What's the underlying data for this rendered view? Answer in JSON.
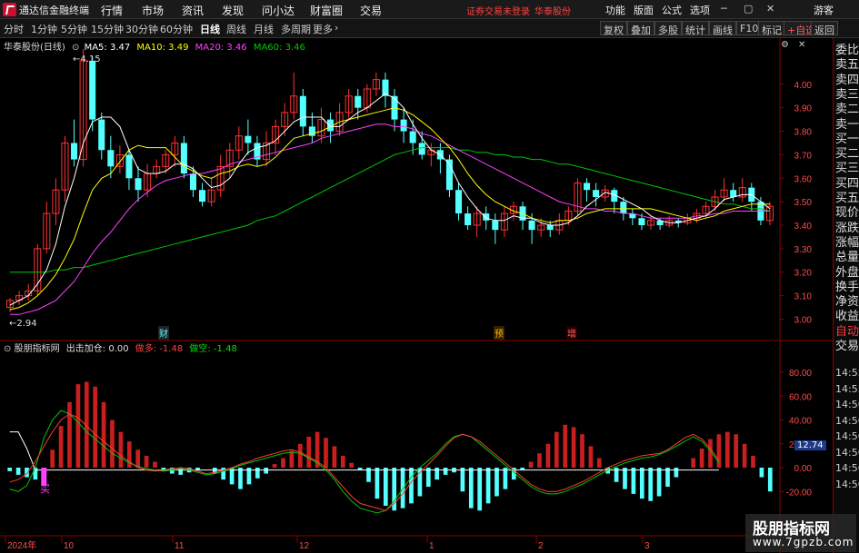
{
  "titlebar": {
    "app_name": "通达信金融终端",
    "menus": [
      "行情",
      "市场",
      "资讯",
      "发现",
      "问小达",
      "财富圈",
      "交易"
    ],
    "warning": "证券交易未登录",
    "broker": "华泰股份",
    "right_menus": [
      "功能",
      "版面",
      "公式",
      "选项"
    ],
    "guest": "游客"
  },
  "toolbar": {
    "periods": [
      "分时",
      "1分钟",
      "5分钟",
      "15分钟",
      "30分钟",
      "60分钟",
      "日线",
      "周线",
      "月线",
      "多周期",
      "更多"
    ],
    "active_period": "日线",
    "buttons": [
      "复权",
      "叠加",
      "多股",
      "统计",
      "画线",
      "F10",
      "标记",
      "+自选",
      "返回"
    ]
  },
  "main_chart": {
    "title": "华泰股份(日线)",
    "ma5_label": "MA5: 3.47",
    "ma10_label": "MA10: 3.49",
    "ma20_label": "MA20: 3.46",
    "ma60_label": "MA60: 3.46",
    "high_label": "4.15",
    "low_label": "2.94",
    "y_ticks": [
      "4.00",
      "3.90",
      "3.80",
      "3.70",
      "3.60",
      "3.50",
      "3.40",
      "3.30",
      "3.20",
      "3.10",
      "3.00"
    ],
    "markers": [
      "财",
      "预",
      "增"
    ],
    "colors": {
      "up": "#ff3232",
      "down": "#54ffff",
      "ma5": "#ffffff",
      "ma10": "#ffff00",
      "ma20": "#ff40ff",
      "ma60": "#00c800"
    }
  },
  "indicator": {
    "title": "股朋指标网",
    "label1": "出击加仓: 0.00",
    "label2": "做多: -1.48",
    "label3": "做空: -1.48",
    "buy_label": "买",
    "y_ticks": [
      "80.00",
      "60.00",
      "40.00",
      "20.00",
      "0.00",
      "-20.00"
    ],
    "current_value": "12.74"
  },
  "xaxis": {
    "labels": [
      "2024年",
      "10",
      "11",
      "12",
      "1",
      "2",
      "3"
    ]
  },
  "right_panel": {
    "items": [
      "委比",
      "卖五",
      "卖四",
      "卖三",
      "卖二",
      "卖一",
      "买一",
      "买二",
      "买三",
      "买四",
      "买五",
      "现价",
      "涨跌",
      "涨幅",
      "总量",
      "外盘",
      "换手",
      "净资",
      "收益",
      "自动",
      "交易",
      "14:55",
      "14:55",
      "14:56",
      "14:56",
      "14:56",
      "14:56",
      "14:56",
      "14:56"
    ]
  },
  "chart_data": {
    "type": "candlestick",
    "title": "华泰股份(日线)",
    "y_range": [
      2.94,
      4.15
    ],
    "candles": [
      [
        3.05,
        3.08,
        3.03,
        3.09
      ],
      [
        3.08,
        3.1,
        3.06,
        3.12
      ],
      [
        3.1,
        3.12,
        3.08,
        3.15
      ],
      [
        3.12,
        3.3,
        3.1,
        3.32
      ],
      [
        3.3,
        3.45,
        3.28,
        3.5
      ],
      [
        3.45,
        3.55,
        3.4,
        3.6
      ],
      [
        3.55,
        3.75,
        3.5,
        3.78
      ],
      [
        3.75,
        3.68,
        3.65,
        3.85
      ],
      [
        3.68,
        4.1,
        3.65,
        4.15
      ],
      [
        4.1,
        3.85,
        3.8,
        4.12
      ],
      [
        3.85,
        3.72,
        3.68,
        3.88
      ],
      [
        3.72,
        3.65,
        3.6,
        3.78
      ],
      [
        3.65,
        3.7,
        3.62,
        3.74
      ],
      [
        3.7,
        3.6,
        3.55,
        3.72
      ],
      [
        3.6,
        3.55,
        3.5,
        3.65
      ],
      [
        3.55,
        3.62,
        3.52,
        3.66
      ],
      [
        3.62,
        3.65,
        3.6,
        3.68
      ],
      [
        3.65,
        3.7,
        3.62,
        3.72
      ],
      [
        3.7,
        3.75,
        3.65,
        3.78
      ],
      [
        3.75,
        3.62,
        3.6,
        3.78
      ],
      [
        3.62,
        3.55,
        3.52,
        3.65
      ],
      [
        3.55,
        3.5,
        3.48,
        3.58
      ],
      [
        3.5,
        3.55,
        3.48,
        3.6
      ],
      [
        3.55,
        3.65,
        3.52,
        3.7
      ],
      [
        3.65,
        3.72,
        3.6,
        3.75
      ],
      [
        3.72,
        3.78,
        3.68,
        3.82
      ],
      [
        3.78,
        3.75,
        3.7,
        3.85
      ],
      [
        3.75,
        3.68,
        3.65,
        3.78
      ],
      [
        3.68,
        3.75,
        3.65,
        3.8
      ],
      [
        3.75,
        3.82,
        3.7,
        3.85
      ],
      [
        3.82,
        3.88,
        3.78,
        3.92
      ],
      [
        3.88,
        3.95,
        3.85,
        4.05
      ],
      [
        3.95,
        3.82,
        3.78,
        3.98
      ],
      [
        3.82,
        3.78,
        3.75,
        3.88
      ],
      [
        3.78,
        3.85,
        3.75,
        3.9
      ],
      [
        3.85,
        3.8,
        3.75,
        3.88
      ],
      [
        3.8,
        3.88,
        3.78,
        3.92
      ],
      [
        3.88,
        3.95,
        3.85,
        3.98
      ],
      [
        3.95,
        3.9,
        3.85,
        3.98
      ],
      [
        3.9,
        3.98,
        3.88,
        4.0
      ],
      [
        3.98,
        4.02,
        3.95,
        4.05
      ],
      [
        4.02,
        3.95,
        3.9,
        4.05
      ],
      [
        3.95,
        3.85,
        3.8,
        3.98
      ],
      [
        3.85,
        3.8,
        3.75,
        3.9
      ],
      [
        3.8,
        3.75,
        3.7,
        3.85
      ],
      [
        3.75,
        3.7,
        3.68,
        3.8
      ],
      [
        3.7,
        3.72,
        3.65,
        3.75
      ],
      [
        3.72,
        3.68,
        3.62,
        3.75
      ],
      [
        3.68,
        3.55,
        3.52,
        3.7
      ],
      [
        3.55,
        3.45,
        3.42,
        3.58
      ],
      [
        3.45,
        3.4,
        3.38,
        3.48
      ],
      [
        3.4,
        3.45,
        3.35,
        3.48
      ],
      [
        3.45,
        3.42,
        3.38,
        3.48
      ],
      [
        3.42,
        3.38,
        3.32,
        3.45
      ],
      [
        3.38,
        3.45,
        3.35,
        3.48
      ],
      [
        3.45,
        3.48,
        3.42,
        3.5
      ],
      [
        3.48,
        3.42,
        3.38,
        3.5
      ],
      [
        3.42,
        3.38,
        3.32,
        3.45
      ],
      [
        3.38,
        3.4,
        3.35,
        3.43
      ],
      [
        3.4,
        3.38,
        3.35,
        3.42
      ],
      [
        3.38,
        3.42,
        3.36,
        3.45
      ],
      [
        3.42,
        3.46,
        3.4,
        3.48
      ],
      [
        3.46,
        3.58,
        3.44,
        3.6
      ],
      [
        3.58,
        3.55,
        3.5,
        3.6
      ],
      [
        3.55,
        3.52,
        3.48,
        3.58
      ],
      [
        3.52,
        3.55,
        3.5,
        3.57
      ],
      [
        3.55,
        3.5,
        3.45,
        3.56
      ],
      [
        3.5,
        3.45,
        3.42,
        3.52
      ],
      [
        3.45,
        3.43,
        3.4,
        3.47
      ],
      [
        3.43,
        3.4,
        3.38,
        3.45
      ],
      [
        3.4,
        3.42,
        3.38,
        3.44
      ],
      [
        3.42,
        3.4,
        3.38,
        3.43
      ],
      [
        3.4,
        3.42,
        3.39,
        3.44
      ],
      [
        3.42,
        3.41,
        3.39,
        3.43
      ],
      [
        3.41,
        3.43,
        3.4,
        3.45
      ],
      [
        3.43,
        3.45,
        3.41,
        3.47
      ],
      [
        3.45,
        3.48,
        3.43,
        3.5
      ],
      [
        3.48,
        3.52,
        3.46,
        3.55
      ],
      [
        3.52,
        3.55,
        3.5,
        3.6
      ],
      [
        3.55,
        3.52,
        3.5,
        3.58
      ],
      [
        3.52,
        3.56,
        3.5,
        3.6
      ],
      [
        3.56,
        3.5,
        3.46,
        3.58
      ],
      [
        3.5,
        3.42,
        3.4,
        3.52
      ],
      [
        3.42,
        3.48,
        3.4,
        3.5
      ]
    ],
    "ma5": [
      3.06,
      3.08,
      3.1,
      3.15,
      3.21,
      3.32,
      3.48,
      3.6,
      3.75,
      3.84,
      3.86,
      3.86,
      3.82,
      3.72,
      3.64,
      3.62,
      3.62,
      3.63,
      3.66,
      3.66,
      3.64,
      3.6,
      3.56,
      3.57,
      3.6,
      3.66,
      3.71,
      3.73,
      3.74,
      3.76,
      3.8,
      3.84,
      3.86,
      3.86,
      3.86,
      3.82,
      3.82,
      3.85,
      3.88,
      3.9,
      3.93,
      3.96,
      3.94,
      3.9,
      3.83,
      3.77,
      3.72,
      3.7,
      3.66,
      3.58,
      3.52,
      3.47,
      3.43,
      3.42,
      3.42,
      3.44,
      3.43,
      3.43,
      3.41,
      3.4,
      3.4,
      3.41,
      3.44,
      3.48,
      3.51,
      3.54,
      3.53,
      3.51,
      3.49,
      3.47,
      3.44,
      3.42,
      3.41,
      3.41,
      3.42,
      3.43,
      3.44,
      3.47,
      3.51,
      3.52,
      3.53,
      3.53,
      3.5,
      3.47
    ],
    "ma10": [
      3.04,
      3.05,
      3.07,
      3.1,
      3.14,
      3.19,
      3.26,
      3.34,
      3.45,
      3.55,
      3.6,
      3.62,
      3.67,
      3.72,
      3.74,
      3.73,
      3.73,
      3.73,
      3.69,
      3.65,
      3.63,
      3.61,
      3.6,
      3.62,
      3.63,
      3.65,
      3.66,
      3.65,
      3.66,
      3.69,
      3.73,
      3.77,
      3.78,
      3.79,
      3.8,
      3.82,
      3.84,
      3.85,
      3.86,
      3.87,
      3.88,
      3.89,
      3.9,
      3.89,
      3.87,
      3.84,
      3.81,
      3.77,
      3.73,
      3.68,
      3.62,
      3.57,
      3.53,
      3.5,
      3.48,
      3.46,
      3.45,
      3.43,
      3.42,
      3.41,
      3.42,
      3.42,
      3.43,
      3.45,
      3.46,
      3.47,
      3.47,
      3.47,
      3.47,
      3.47,
      3.47,
      3.46,
      3.45,
      3.44,
      3.43,
      3.42,
      3.43,
      3.44,
      3.46,
      3.47,
      3.48,
      3.49,
      3.49,
      3.49
    ],
    "ma20": [
      3.02,
      3.02,
      3.03,
      3.04,
      3.06,
      3.08,
      3.12,
      3.16,
      3.22,
      3.28,
      3.33,
      3.37,
      3.42,
      3.47,
      3.51,
      3.54,
      3.57,
      3.59,
      3.6,
      3.61,
      3.62,
      3.62,
      3.63,
      3.64,
      3.66,
      3.67,
      3.68,
      3.69,
      3.7,
      3.71,
      3.72,
      3.73,
      3.74,
      3.75,
      3.77,
      3.78,
      3.79,
      3.8,
      3.81,
      3.82,
      3.83,
      3.83,
      3.82,
      3.82,
      3.81,
      3.79,
      3.78,
      3.76,
      3.74,
      3.72,
      3.7,
      3.68,
      3.66,
      3.64,
      3.62,
      3.6,
      3.58,
      3.56,
      3.54,
      3.52,
      3.5,
      3.49,
      3.48,
      3.47,
      3.47,
      3.46,
      3.46,
      3.45,
      3.45,
      3.44,
      3.43,
      3.43,
      3.43,
      3.43,
      3.43,
      3.44,
      3.44,
      3.45,
      3.45,
      3.46,
      3.46,
      3.46,
      3.46,
      3.46
    ],
    "ma60": [
      3.2,
      3.2,
      3.2,
      3.2,
      3.2,
      3.21,
      3.21,
      3.22,
      3.22,
      3.23,
      3.24,
      3.25,
      3.26,
      3.27,
      3.28,
      3.29,
      3.3,
      3.31,
      3.32,
      3.33,
      3.34,
      3.35,
      3.36,
      3.37,
      3.38,
      3.39,
      3.4,
      3.42,
      3.43,
      3.44,
      3.46,
      3.48,
      3.5,
      3.52,
      3.54,
      3.56,
      3.58,
      3.6,
      3.62,
      3.64,
      3.66,
      3.68,
      3.7,
      3.71,
      3.72,
      3.73,
      3.73,
      3.73,
      3.73,
      3.72,
      3.72,
      3.71,
      3.71,
      3.7,
      3.7,
      3.69,
      3.69,
      3.68,
      3.68,
      3.67,
      3.66,
      3.66,
      3.65,
      3.64,
      3.63,
      3.62,
      3.61,
      3.6,
      3.59,
      3.58,
      3.57,
      3.56,
      3.55,
      3.54,
      3.53,
      3.52,
      3.51,
      3.5,
      3.49,
      3.49,
      3.48,
      3.47,
      3.47,
      3.46
    ],
    "osc_bars": [
      -3,
      -6,
      -8,
      -10,
      -12,
      15,
      35,
      55,
      70,
      72,
      68,
      55,
      40,
      30,
      22,
      15,
      10,
      5,
      -3,
      -5,
      -6,
      -4,
      -2,
      0,
      -5,
      -10,
      -14,
      -18,
      -14,
      -9,
      -5,
      3,
      8,
      14,
      20,
      26,
      30,
      25,
      18,
      10,
      4,
      -2,
      -12,
      -26,
      -32,
      -36,
      -34,
      -30,
      -24,
      -16,
      -10,
      -6,
      -4,
      -20,
      -34,
      -36,
      -30,
      -24,
      -18,
      -10,
      -2,
      5,
      12,
      20,
      30,
      36,
      34,
      28,
      18,
      8,
      -5,
      -12,
      -18,
      -22,
      -26,
      -28,
      -24,
      -16,
      -8,
      0,
      8,
      16,
      24,
      28,
      30,
      28,
      20,
      10,
      -8,
      -20
    ],
    "osc_red": [
      -12,
      -10,
      -5,
      5,
      18,
      30,
      40,
      45,
      42,
      35,
      28,
      22,
      16,
      10,
      5,
      0,
      -2,
      -3,
      -2,
      -1,
      0,
      -1,
      -3,
      -5,
      -4,
      -2,
      0,
      3,
      5,
      8,
      10,
      12,
      14,
      15,
      13,
      9,
      5,
      0,
      -8,
      -16,
      -24,
      -30,
      -32,
      -34,
      -36,
      -30,
      -22,
      -12,
      -4,
      3,
      10,
      18,
      25,
      28,
      26,
      22,
      16,
      10,
      4,
      -2,
      -8,
      -14,
      -18,
      -20,
      -20,
      -18,
      -15,
      -12,
      -8,
      -4,
      0,
      3,
      6,
      8,
      10,
      11,
      12,
      15,
      20,
      25,
      28,
      24,
      16,
      6
    ],
    "osc_green": [
      -18,
      -20,
      -15,
      0,
      25,
      40,
      48,
      45,
      38,
      30,
      24,
      18,
      12,
      8,
      4,
      1,
      -1,
      -2,
      -3,
      -2,
      -1,
      -2,
      -4,
      -6,
      -5,
      -3,
      -1,
      2,
      4,
      6,
      8,
      10,
      12,
      13,
      12,
      8,
      4,
      -2,
      -10,
      -20,
      -28,
      -34,
      -36,
      -38,
      -36,
      -28,
      -18,
      -8,
      0,
      6,
      12,
      20,
      26,
      28,
      26,
      20,
      14,
      8,
      2,
      -4,
      -10,
      -16,
      -20,
      -22,
      -22,
      -20,
      -17,
      -14,
      -10,
      -6,
      -2,
      1,
      4,
      6,
      8,
      9,
      11,
      14,
      18,
      22,
      26,
      22,
      14,
      4
    ],
    "osc_white": [
      30,
      30,
      16,
      -2,
      -2,
      -2,
      -2,
      -2,
      -2,
      -2,
      -2,
      -2,
      -2,
      -2,
      -2,
      -2,
      -2,
      -2,
      -2,
      -2,
      -2,
      -2,
      -2,
      -2,
      -2,
      -2,
      -2,
      -2,
      -2,
      -2,
      -2,
      -2,
      -2,
      -2,
      -2,
      -2,
      -2,
      -2,
      -2,
      -2,
      -2,
      -2,
      -2,
      -2,
      -2,
      -2,
      -2,
      -2,
      -2,
      -2,
      -2,
      -2,
      -2,
      -2,
      -2,
      -2,
      -2,
      -2,
      -2,
      -2,
      -2,
      -2,
      -2,
      -2,
      -2,
      -2,
      -2,
      -2,
      -2,
      -2,
      -2,
      -2,
      -2,
      -2,
      -2,
      -2,
      -2,
      -2,
      -2,
      -2,
      -2,
      -2,
      -2,
      -2
    ]
  }
}
